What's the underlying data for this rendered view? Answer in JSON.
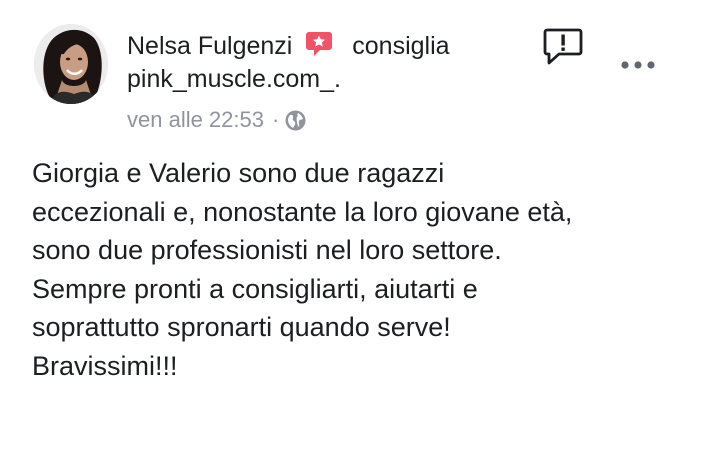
{
  "post": {
    "author_name": "Nelsa Fulgenzi",
    "action": "consiglia",
    "page_name": "pink_muscle.com_.",
    "timestamp": "ven alle 22:53",
    "separator": "·",
    "privacy_icon": "globe-icon",
    "recommend_icon": "recommend-star-icon",
    "report_icon": "report-exclamation-icon",
    "more_icon": "more-horizontal-icon",
    "body_lines": [
      "Giorgia e Valerio sono due ragazzi",
      "eccezionali e, nonostante la loro giovane età,",
      "sono due professionisti nel loro settore.",
      "Sempre pronti a consigliarti, aiutarti e",
      "soprattutto spronarti quando serve!",
      "Bravissimi!!!"
    ]
  },
  "colors": {
    "text": "#1c1e21",
    "meta": "#90949c",
    "recommend": "#f25268",
    "icon": "#1c1e21"
  }
}
